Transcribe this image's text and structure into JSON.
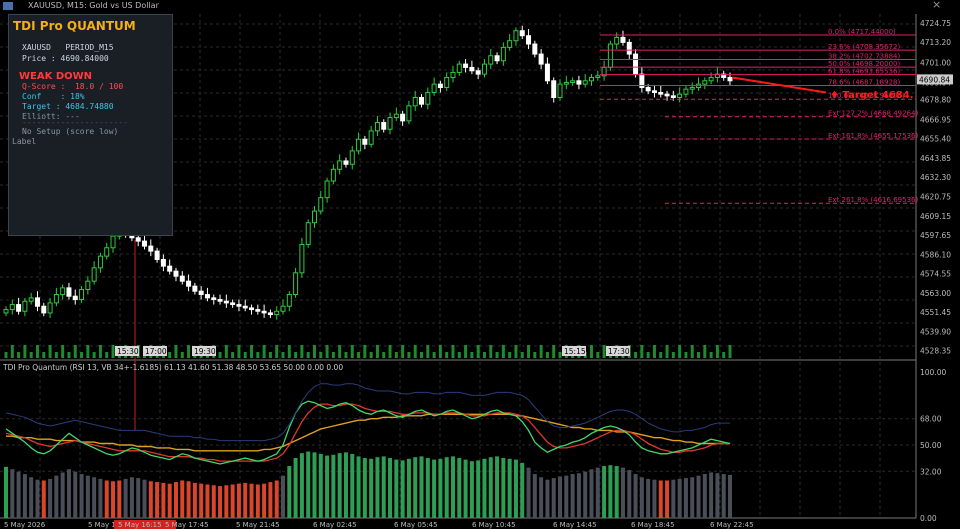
{
  "window": {
    "title": "XAUUSD, M15:  Gold vs US Dollar",
    "close_glyph": "×"
  },
  "colors": {
    "background": "#000000",
    "grid": "#2a2a2a",
    "bull": "#2ecc40",
    "bear": "#ffffff",
    "fib": "#e0206e",
    "target": "#ff1a1a",
    "panel_title": "#f2b019",
    "weak_down": "#ff3b3b"
  },
  "panel": {
    "title": "TDI Pro QUANTUM",
    "symbol_line": "XAUUSD   PERIOD_M15",
    "price_line": "Price : 4690.84000",
    "signal": "WEAK DOWN",
    "qscore": "Q-Score :  18.0 / 100",
    "conf": "Conf    : 18%",
    "target": "Target : 4684.74880",
    "elliott": "Elliott: ---",
    "separator": "----------------------",
    "setup": "No Setup (score low)",
    "label": "Label"
  },
  "price_axis": {
    "ticks": [
      "4724.75",
      "4713.20",
      "4701.00",
      "4689.04",
      "4678.80",
      "4666.95",
      "4655.40",
      "4643.85",
      "4632.30",
      "4620.75",
      "4609.15",
      "4597.65",
      "4586.10",
      "4574.55",
      "4563.00",
      "4551.45",
      "4539.90",
      "4528.35"
    ],
    "current_price": "4690.84"
  },
  "fib_levels": [
    {
      "text": "0.0% (4717.44000)"
    },
    {
      "text": "23.6% (4708.35672)"
    },
    {
      "text": "38.2% (4702.73884)"
    },
    {
      "text": "50.0% (4698.20000)"
    },
    {
      "text": "61.8% (4693.65536)"
    },
    {
      "text": "78.6% (4687.18928)"
    },
    {
      "text": "100.0% (4678.96000)"
    },
    {
      "text": "Ext 127.2% (4668.49264)"
    },
    {
      "text": "Ext 161.8% (4655.17536)"
    },
    {
      "text": "Ext 261.8% (4616.69536)"
    }
  ],
  "target_label": "Target 4684.",
  "time_marks": [
    {
      "text": "15:30"
    },
    {
      "text": "17:00"
    },
    {
      "text": "19:30"
    },
    {
      "text": "15:15"
    },
    {
      "text": "17:30"
    }
  ],
  "indicator": {
    "header": "TDI Pro Quantum (RSI 13, VB 34+-1.6185) 61.13 41.60 51.38 48.50 53.65 50.00 0.00 0.00",
    "axis_ticks": [
      "100.00",
      "68.00",
      "50.00",
      "32.00",
      "0.00"
    ]
  },
  "time_axis": {
    "labels": [
      "5 May 2026",
      "5 May 14:45",
      "5 May 16:15",
      "5 May 17:45",
      "5 May 21:45",
      "6 May 02:45",
      "6 May 05:45",
      "6 May 10:45",
      "6 May 14:45",
      "6 May 18:45",
      "6 May 22:45"
    ]
  },
  "chart_data": {
    "type": "candlestick",
    "symbol": "XAUUSD",
    "timeframe": "M15",
    "ylim": [
      4524,
      4730
    ],
    "closes": [
      4553,
      4556,
      4552,
      4558,
      4560,
      4555,
      4551,
      4557,
      4562,
      4566,
      4561,
      4559,
      4565,
      4570,
      4578,
      4585,
      4590,
      4597,
      4603,
      4599,
      4596,
      4594,
      4591,
      4588,
      4583,
      4579,
      4576,
      4573,
      4570,
      4567,
      4564,
      4562,
      4560,
      4559,
      4558,
      4557,
      4556,
      4555,
      4554,
      4553,
      4552,
      4551,
      4550,
      4552,
      4555,
      4562,
      4575,
      4592,
      4605,
      4612,
      4620,
      4630,
      4637,
      4642,
      4640,
      4648,
      4655,
      4652,
      4660,
      4665,
      4661,
      4668,
      4670,
      4666,
      4675,
      4680,
      4676,
      4683,
      4688,
      4686,
      4692,
      4695,
      4700,
      4698,
      4696,
      4694,
      4700,
      4705,
      4702,
      4710,
      4714,
      4720,
      4717,
      4712,
      4706,
      4700,
      4690,
      4680,
      4688,
      4689,
      4690,
      4688,
      4690,
      4692,
      4693,
      4698,
      4712,
      4716,
      4713,
      4706,
      4694,
      4686,
      4684,
      4683,
      4682,
      4681,
      4680,
      4682,
      4685,
      4686,
      4688,
      4690,
      4692,
      4694,
      4692,
      4690
    ],
    "rsi_green": [
      61,
      58,
      55,
      52,
      48,
      45,
      44,
      46,
      50,
      54,
      58,
      55,
      52,
      50,
      48,
      46,
      44,
      43,
      44,
      46,
      48,
      47,
      45,
      43,
      42,
      41,
      40,
      42,
      44,
      43,
      41,
      40,
      39,
      38,
      37,
      38,
      39,
      40,
      41,
      40,
      39,
      40,
      42,
      44,
      50,
      62,
      72,
      78,
      80,
      79,
      77,
      75,
      76,
      78,
      79,
      77,
      74,
      72,
      71,
      73,
      74,
      72,
      70,
      69,
      71,
      73,
      74,
      72,
      70,
      71,
      73,
      74,
      72,
      70,
      68,
      69,
      71,
      73,
      74,
      72,
      71,
      70,
      66,
      60,
      52,
      48,
      45,
      47,
      49,
      50,
      52,
      53,
      55,
      58,
      60,
      62,
      63,
      62,
      60,
      57,
      52,
      48,
      46,
      45,
      44,
      44,
      45,
      46,
      47,
      48,
      50,
      52,
      54,
      53,
      52,
      51
    ],
    "rsi_red": [
      58,
      57,
      56,
      55,
      53,
      51,
      50,
      49,
      50,
      51,
      52,
      53,
      52,
      51,
      50,
      49,
      48,
      47,
      46,
      46,
      46,
      46,
      46,
      45,
      44,
      43,
      42,
      42,
      42,
      42,
      41,
      41,
      40,
      40,
      39,
      39,
      39,
      39,
      39,
      39,
      39,
      39,
      40,
      41,
      44,
      50,
      58,
      66,
      72,
      76,
      78,
      78,
      77,
      77,
      78,
      78,
      77,
      75,
      74,
      73,
      73,
      73,
      72,
      71,
      71,
      72,
      72,
      72,
      71,
      71,
      72,
      72,
      72,
      71,
      70,
      70,
      70,
      71,
      72,
      72,
      72,
      71,
      70,
      67,
      62,
      57,
      52,
      49,
      48,
      48,
      49,
      50,
      51,
      53,
      55,
      57,
      59,
      60,
      60,
      59,
      57,
      54,
      51,
      49,
      47,
      46,
      45,
      45,
      46,
      46,
      47,
      48,
      50,
      51,
      51,
      51
    ],
    "signal_line": [
      56,
      56,
      55,
      55,
      55,
      54,
      54,
      54,
      53,
      53,
      53,
      53,
      52,
      52,
      52,
      51,
      51,
      51,
      50,
      50,
      50,
      49,
      49,
      49,
      48,
      48,
      48,
      47,
      47,
      47,
      46,
      46,
      46,
      46,
      46,
      46,
      46,
      46,
      46,
      46,
      46,
      47,
      47,
      48,
      49,
      51,
      53,
      55,
      57,
      59,
      61,
      62,
      63,
      64,
      65,
      66,
      67,
      67,
      68,
      68,
      69,
      69,
      69,
      70,
      70,
      70,
      70,
      71,
      71,
      71,
      71,
      71,
      71,
      71,
      71,
      71,
      71,
      71,
      71,
      71,
      71,
      70,
      70,
      69,
      68,
      67,
      66,
      65,
      64,
      63,
      62,
      62,
      61,
      61,
      60,
      60,
      60,
      59,
      59,
      59,
      58,
      57,
      56,
      55,
      55,
      54,
      53,
      53,
      52,
      52,
      51,
      51,
      51,
      51,
      51,
      51
    ]
  }
}
